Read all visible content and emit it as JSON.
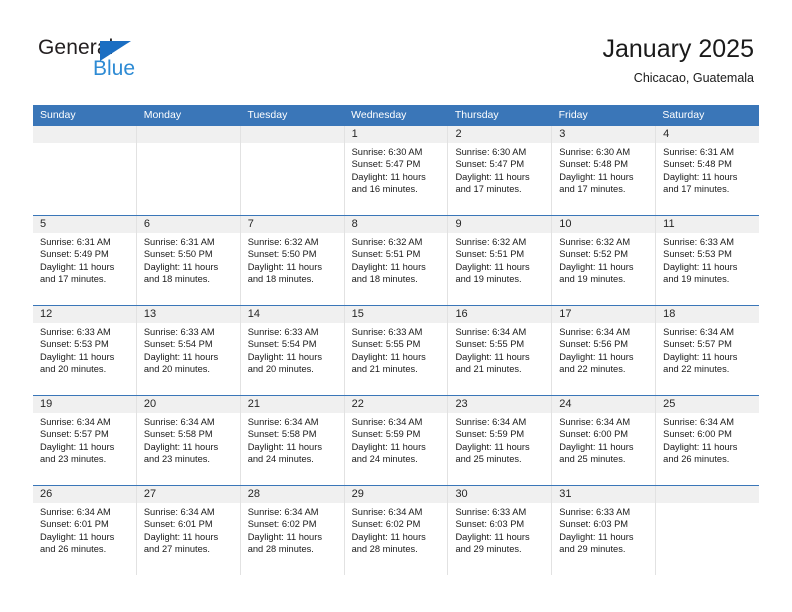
{
  "logo": {
    "word1": "General",
    "word2": "Blue",
    "triangle_color": "#1b6ec2",
    "word2_color": "#2e8bd4"
  },
  "header": {
    "title": "January 2025",
    "subtitle": "Chicacao, Guatemala"
  },
  "theme": {
    "header_blue": "#3a76b8",
    "day_band_gray": "#f0f0f0",
    "cell_border": "#e2e2e2"
  },
  "calendar": {
    "weekdays": [
      "Sunday",
      "Monday",
      "Tuesday",
      "Wednesday",
      "Thursday",
      "Friday",
      "Saturday"
    ],
    "weeks": [
      [
        {
          "day": "",
          "empty": true,
          "sunrise": "",
          "sunset": "",
          "daylight": ""
        },
        {
          "day": "",
          "empty": true,
          "sunrise": "",
          "sunset": "",
          "daylight": ""
        },
        {
          "day": "",
          "empty": true,
          "sunrise": "",
          "sunset": "",
          "daylight": ""
        },
        {
          "day": "1",
          "empty": false,
          "sunrise": "Sunrise: 6:30 AM",
          "sunset": "Sunset: 5:47 PM",
          "daylight": "Daylight: 11 hours and 16 minutes."
        },
        {
          "day": "2",
          "empty": false,
          "sunrise": "Sunrise: 6:30 AM",
          "sunset": "Sunset: 5:47 PM",
          "daylight": "Daylight: 11 hours and 17 minutes."
        },
        {
          "day": "3",
          "empty": false,
          "sunrise": "Sunrise: 6:30 AM",
          "sunset": "Sunset: 5:48 PM",
          "daylight": "Daylight: 11 hours and 17 minutes."
        },
        {
          "day": "4",
          "empty": false,
          "sunrise": "Sunrise: 6:31 AM",
          "sunset": "Sunset: 5:48 PM",
          "daylight": "Daylight: 11 hours and 17 minutes."
        }
      ],
      [
        {
          "day": "5",
          "empty": false,
          "sunrise": "Sunrise: 6:31 AM",
          "sunset": "Sunset: 5:49 PM",
          "daylight": "Daylight: 11 hours and 17 minutes."
        },
        {
          "day": "6",
          "empty": false,
          "sunrise": "Sunrise: 6:31 AM",
          "sunset": "Sunset: 5:50 PM",
          "daylight": "Daylight: 11 hours and 18 minutes."
        },
        {
          "day": "7",
          "empty": false,
          "sunrise": "Sunrise: 6:32 AM",
          "sunset": "Sunset: 5:50 PM",
          "daylight": "Daylight: 11 hours and 18 minutes."
        },
        {
          "day": "8",
          "empty": false,
          "sunrise": "Sunrise: 6:32 AM",
          "sunset": "Sunset: 5:51 PM",
          "daylight": "Daylight: 11 hours and 18 minutes."
        },
        {
          "day": "9",
          "empty": false,
          "sunrise": "Sunrise: 6:32 AM",
          "sunset": "Sunset: 5:51 PM",
          "daylight": "Daylight: 11 hours and 19 minutes."
        },
        {
          "day": "10",
          "empty": false,
          "sunrise": "Sunrise: 6:32 AM",
          "sunset": "Sunset: 5:52 PM",
          "daylight": "Daylight: 11 hours and 19 minutes."
        },
        {
          "day": "11",
          "empty": false,
          "sunrise": "Sunrise: 6:33 AM",
          "sunset": "Sunset: 5:53 PM",
          "daylight": "Daylight: 11 hours and 19 minutes."
        }
      ],
      [
        {
          "day": "12",
          "empty": false,
          "sunrise": "Sunrise: 6:33 AM",
          "sunset": "Sunset: 5:53 PM",
          "daylight": "Daylight: 11 hours and 20 minutes."
        },
        {
          "day": "13",
          "empty": false,
          "sunrise": "Sunrise: 6:33 AM",
          "sunset": "Sunset: 5:54 PM",
          "daylight": "Daylight: 11 hours and 20 minutes."
        },
        {
          "day": "14",
          "empty": false,
          "sunrise": "Sunrise: 6:33 AM",
          "sunset": "Sunset: 5:54 PM",
          "daylight": "Daylight: 11 hours and 20 minutes."
        },
        {
          "day": "15",
          "empty": false,
          "sunrise": "Sunrise: 6:33 AM",
          "sunset": "Sunset: 5:55 PM",
          "daylight": "Daylight: 11 hours and 21 minutes."
        },
        {
          "day": "16",
          "empty": false,
          "sunrise": "Sunrise: 6:34 AM",
          "sunset": "Sunset: 5:55 PM",
          "daylight": "Daylight: 11 hours and 21 minutes."
        },
        {
          "day": "17",
          "empty": false,
          "sunrise": "Sunrise: 6:34 AM",
          "sunset": "Sunset: 5:56 PM",
          "daylight": "Daylight: 11 hours and 22 minutes."
        },
        {
          "day": "18",
          "empty": false,
          "sunrise": "Sunrise: 6:34 AM",
          "sunset": "Sunset: 5:57 PM",
          "daylight": "Daylight: 11 hours and 22 minutes."
        }
      ],
      [
        {
          "day": "19",
          "empty": false,
          "sunrise": "Sunrise: 6:34 AM",
          "sunset": "Sunset: 5:57 PM",
          "daylight": "Daylight: 11 hours and 23 minutes."
        },
        {
          "day": "20",
          "empty": false,
          "sunrise": "Sunrise: 6:34 AM",
          "sunset": "Sunset: 5:58 PM",
          "daylight": "Daylight: 11 hours and 23 minutes."
        },
        {
          "day": "21",
          "empty": false,
          "sunrise": "Sunrise: 6:34 AM",
          "sunset": "Sunset: 5:58 PM",
          "daylight": "Daylight: 11 hours and 24 minutes."
        },
        {
          "day": "22",
          "empty": false,
          "sunrise": "Sunrise: 6:34 AM",
          "sunset": "Sunset: 5:59 PM",
          "daylight": "Daylight: 11 hours and 24 minutes."
        },
        {
          "day": "23",
          "empty": false,
          "sunrise": "Sunrise: 6:34 AM",
          "sunset": "Sunset: 5:59 PM",
          "daylight": "Daylight: 11 hours and 25 minutes."
        },
        {
          "day": "24",
          "empty": false,
          "sunrise": "Sunrise: 6:34 AM",
          "sunset": "Sunset: 6:00 PM",
          "daylight": "Daylight: 11 hours and 25 minutes."
        },
        {
          "day": "25",
          "empty": false,
          "sunrise": "Sunrise: 6:34 AM",
          "sunset": "Sunset: 6:00 PM",
          "daylight": "Daylight: 11 hours and 26 minutes."
        }
      ],
      [
        {
          "day": "26",
          "empty": false,
          "sunrise": "Sunrise: 6:34 AM",
          "sunset": "Sunset: 6:01 PM",
          "daylight": "Daylight: 11 hours and 26 minutes."
        },
        {
          "day": "27",
          "empty": false,
          "sunrise": "Sunrise: 6:34 AM",
          "sunset": "Sunset: 6:01 PM",
          "daylight": "Daylight: 11 hours and 27 minutes."
        },
        {
          "day": "28",
          "empty": false,
          "sunrise": "Sunrise: 6:34 AM",
          "sunset": "Sunset: 6:02 PM",
          "daylight": "Daylight: 11 hours and 28 minutes."
        },
        {
          "day": "29",
          "empty": false,
          "sunrise": "Sunrise: 6:34 AM",
          "sunset": "Sunset: 6:02 PM",
          "daylight": "Daylight: 11 hours and 28 minutes."
        },
        {
          "day": "30",
          "empty": false,
          "sunrise": "Sunrise: 6:33 AM",
          "sunset": "Sunset: 6:03 PM",
          "daylight": "Daylight: 11 hours and 29 minutes."
        },
        {
          "day": "31",
          "empty": false,
          "sunrise": "Sunrise: 6:33 AM",
          "sunset": "Sunset: 6:03 PM",
          "daylight": "Daylight: 11 hours and 29 minutes."
        },
        {
          "day": "",
          "empty": true,
          "sunrise": "",
          "sunset": "",
          "daylight": ""
        }
      ]
    ]
  }
}
